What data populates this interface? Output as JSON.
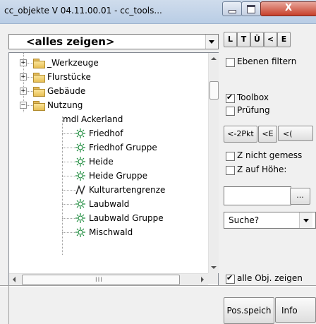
{
  "window": {
    "title": "cc_objekte V 04.11.00.01 - cc_tools...",
    "close_glyph": "X"
  },
  "filter": {
    "selected": "<alles zeigen>"
  },
  "tree": {
    "nodes": [
      {
        "label": "_Werkzeuge",
        "kind": "folder",
        "expander": "+"
      },
      {
        "label": "Flurstücke",
        "kind": "folder",
        "expander": "+"
      },
      {
        "label": "Gebäude",
        "kind": "folder",
        "expander": "+"
      },
      {
        "label": "Nutzung",
        "kind": "folder",
        "expander": "−"
      },
      {
        "label": "Ackerland",
        "kind": "mdl",
        "prefix": "mdl"
      },
      {
        "label": "Friedhof",
        "kind": "symbol"
      },
      {
        "label": "Friedhof Gruppe",
        "kind": "symbol"
      },
      {
        "label": "Heide",
        "kind": "symbol"
      },
      {
        "label": "Heide Gruppe",
        "kind": "symbol"
      },
      {
        "label": "Kulturartengrenze",
        "kind": "line"
      },
      {
        "label": "Laubwald",
        "kind": "symbol"
      },
      {
        "label": "Laubwald Gruppe",
        "kind": "symbol"
      },
      {
        "label": "Mischwald",
        "kind": "symbol"
      }
    ],
    "hscroll_grip": "III"
  },
  "toolbar": {
    "buttons": [
      "L",
      "T",
      "Ü",
      "<",
      "E"
    ]
  },
  "options": {
    "ebenen_filtern": "Ebenen filtern",
    "toolbox": "Toolbox",
    "pruefung": "Prüfung",
    "z_nicht": "Z nicht gemess",
    "z_hoehe": "Z auf Höhe:",
    "alle_obj": "alle Obj. zeigen"
  },
  "nav_buttons": [
    "<-2Pkt",
    "<E",
    "<("
  ],
  "browse_label": "...",
  "search": {
    "value": "Suche?"
  },
  "bottom_buttons": {
    "pos": "Pos.speich",
    "info": "Info"
  }
}
